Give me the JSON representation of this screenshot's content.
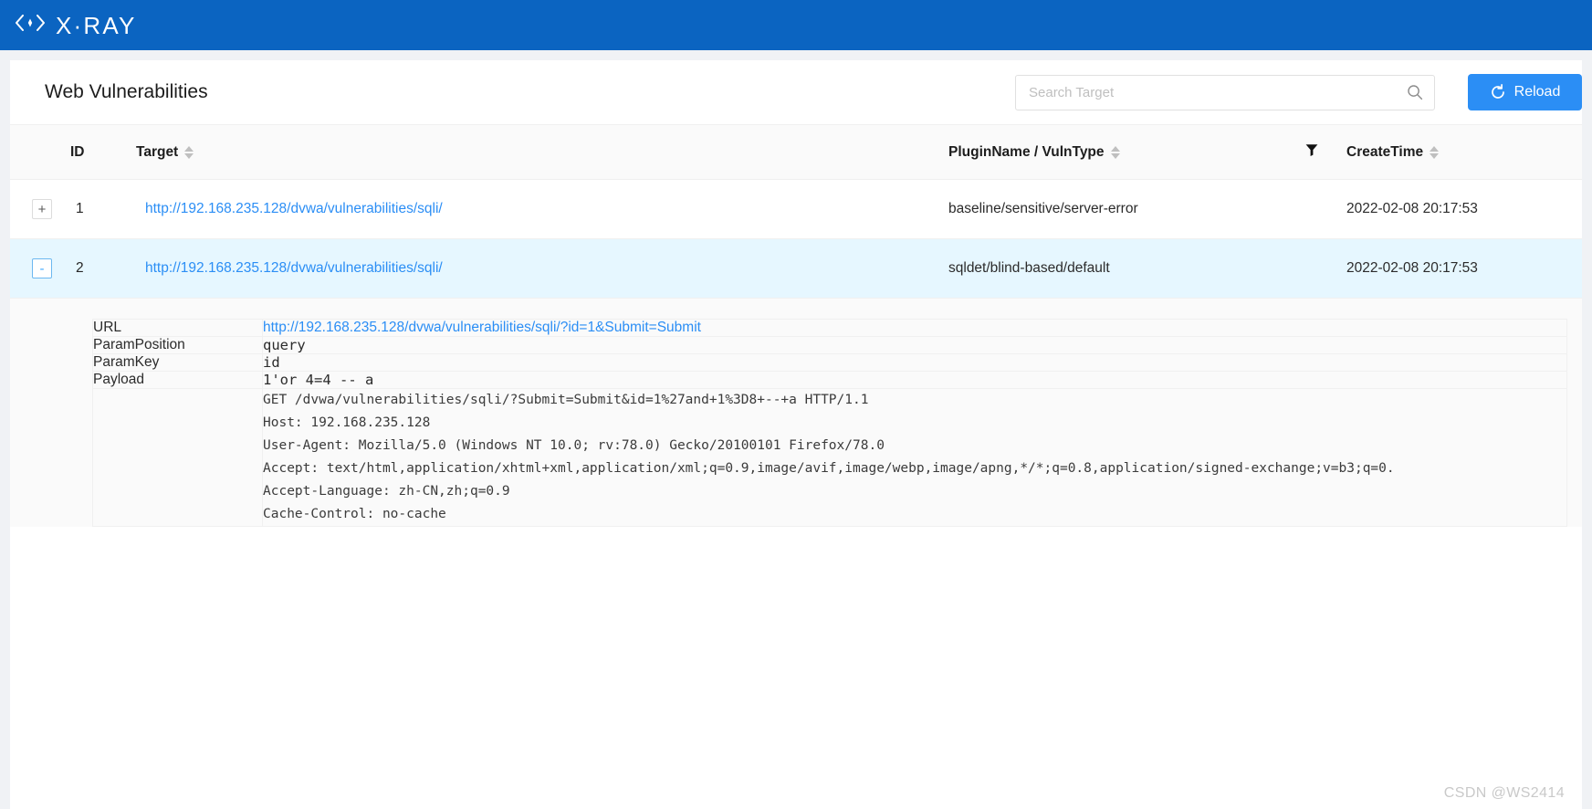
{
  "brand": {
    "logo_icon": "xray-chevrons-icon",
    "name": "X·RAY"
  },
  "header": {
    "title": "Web Vulnerabilities",
    "search": {
      "placeholder": "Search Target",
      "value": "",
      "icon": "search-icon"
    },
    "reload_button": {
      "label": "Reload",
      "icon": "refresh-icon",
      "color": "#2b8ef5"
    }
  },
  "table": {
    "columns": {
      "expand": "",
      "id": "ID",
      "target": "Target",
      "plugin": "PluginName / VulnType",
      "filter_icon": "filter-funnel-icon",
      "createtime": "CreateTime"
    },
    "rows": [
      {
        "expand_label": "+",
        "expanded": false,
        "selected": false,
        "id": "1",
        "target": "http://192.168.235.128/dvwa/vulnerabilities/sqli/",
        "plugin": "baseline/sensitive/server-error",
        "createtime": "2022-02-08 20:17:53"
      },
      {
        "expand_label": "-",
        "expanded": true,
        "selected": true,
        "id": "2",
        "target": "http://192.168.235.128/dvwa/vulnerabilities/sqli/",
        "plugin": "sqldet/blind-based/default",
        "createtime": "2022-02-08 20:17:53"
      }
    ]
  },
  "detail": {
    "fields": [
      {
        "label": "URL",
        "value": "http://192.168.235.128/dvwa/vulnerabilities/sqli/?id=1&Submit=Submit",
        "is_link": true
      },
      {
        "label": "ParamPosition",
        "value": "query",
        "is_link": false
      },
      {
        "label": "ParamKey",
        "value": "id",
        "is_link": false
      },
      {
        "label": "Payload",
        "value": "1'or 4=4 -- a",
        "is_link": false
      }
    ],
    "request": "GET /dvwa/vulnerabilities/sqli/?Submit=Submit&id=1%27and+1%3D8+--+a HTTP/1.1\nHost: 192.168.235.128\nUser-Agent: Mozilla/5.0 (Windows NT 10.0; rv:78.0) Gecko/20100101 Firefox/78.0\nAccept: text/html,application/xhtml+xml,application/xml;q=0.9,image/avif,image/webp,image/apng,*/*;q=0.8,application/signed-exchange;v=b3;q=0.\nAccept-Language: zh-CN,zh;q=0.9\nCache-Control: no-cache"
  },
  "watermark": "CSDN @WS2414",
  "colors": {
    "brandbar": "#0b64c1",
    "accent": "#2b8ef5",
    "link": "#2b8ef5",
    "selected_row": "#e6f7ff",
    "page_bg": "#f0f2f5"
  }
}
